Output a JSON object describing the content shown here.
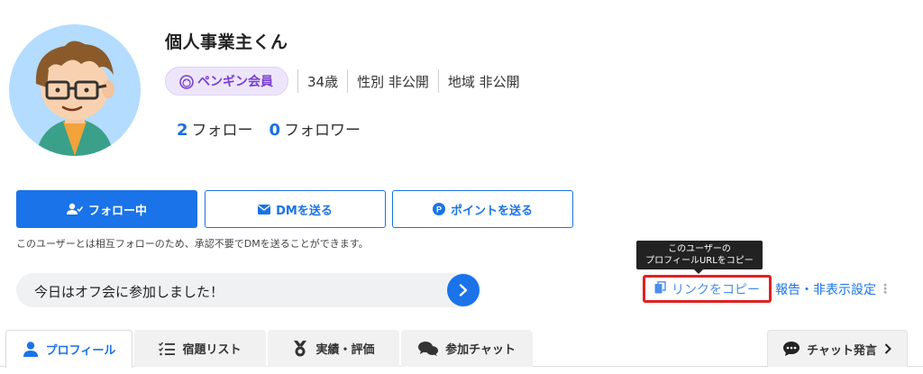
{
  "profile": {
    "username": "個人事業主くん",
    "member_badge": "ペンギン会員",
    "age": "34歳",
    "gender": "性別 非公開",
    "region": "地域 非公開",
    "follow_count": "2",
    "follow_label": "フォロー",
    "follower_count": "0",
    "follower_label": "フォロワー"
  },
  "actions": {
    "following_label": "フォロー中",
    "dm_label": "DMを送る",
    "point_label": "ポイントを送る",
    "note": "このユーザーとは相互フォローのため、承認不要でDMを送ることができます。"
  },
  "status": {
    "message": "今日はオフ会に参加しました！"
  },
  "links": {
    "tooltip_line1": "このユーザーの",
    "tooltip_line2": "プロフィールURLをコピー",
    "copy_link_label": "リンクをコピー",
    "report_label": "報告・非表示設定"
  },
  "tabs": [
    {
      "label": "プロフィール",
      "icon": "person-icon"
    },
    {
      "label": "宿題リスト",
      "icon": "checklist-icon"
    },
    {
      "label": "実績・評価",
      "icon": "medal-icon"
    },
    {
      "label": "参加チャット",
      "icon": "chat-bubbles-icon"
    }
  ],
  "chat_tab": {
    "label": "チャット発言",
    "icon": "chat-dots-icon"
  },
  "colors": {
    "accent": "#1a73e8",
    "badge_text": "#7a3fd0",
    "badge_bg": "#ede6fb",
    "highlight_border": "#e02020",
    "avatar_bg": "#b3dcff"
  }
}
